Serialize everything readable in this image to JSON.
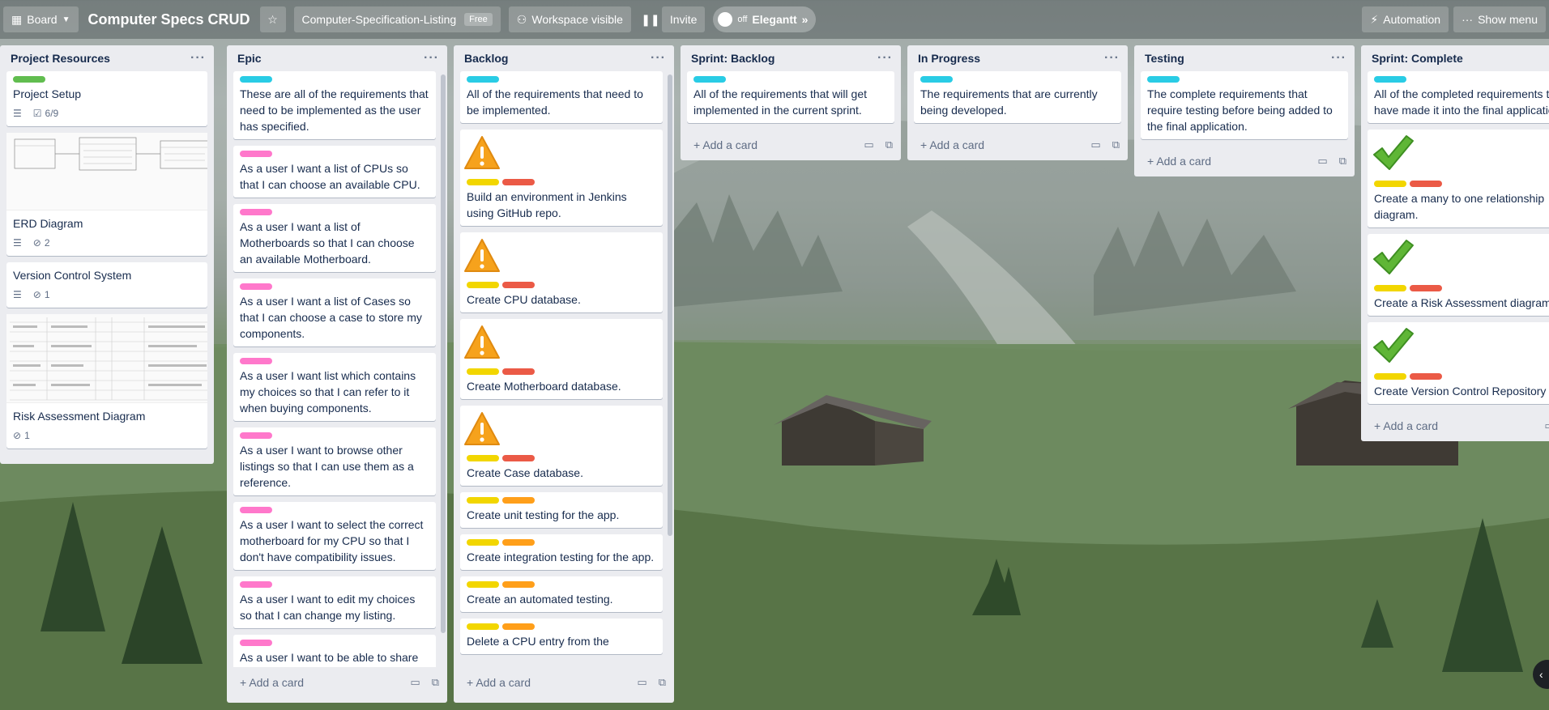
{
  "header": {
    "board_switcher": "Board",
    "board_title": "Computer Specs CRUD",
    "workspace_name": "Computer-Specification-Listing",
    "workspace_badge": "Free",
    "visibility": "Workspace visible",
    "invite": "Invite",
    "toggle_state": "off",
    "powerup_name": "Elegantt",
    "automation": "Automation",
    "show_menu": "Show menu"
  },
  "add_card_label": "Add a card",
  "colors": {
    "cyan": "#29cce5",
    "green": "#61bd4f",
    "pink": "#ff78cb",
    "yellow": "#f2d600",
    "red": "#eb5a46",
    "orange": "#ff9f1a"
  },
  "lists": [
    {
      "title": "Project Resources",
      "cards": [
        {
          "title": "Project Setup",
          "labels": [
            "green"
          ],
          "badges": {
            "description": true,
            "checklist": "6/9"
          }
        },
        {
          "title": "ERD Diagram",
          "cover": "erd",
          "badges": {
            "description": true,
            "attachments": "2"
          }
        },
        {
          "title": "Version Control System",
          "badges": {
            "description": true,
            "attachments": "1"
          }
        },
        {
          "title": "Risk Assessment Diagram",
          "cover": "table",
          "badges": {
            "attachments": "1"
          }
        }
      ]
    },
    {
      "title": "Epic",
      "cards": [
        {
          "title": "These are all of the requirements that need to be implemented as the user has specified.",
          "labels": [
            "cyan"
          ]
        },
        {
          "title": "As a user I want a list of CPUs so that I can choose an available CPU.",
          "labels": [
            "pink"
          ]
        },
        {
          "title": "As a user I want a list of Motherboards so that I can choose an available Motherboard.",
          "labels": [
            "pink"
          ]
        },
        {
          "title": "As a user I want a list of Cases so that I can choose a case to store my components.",
          "labels": [
            "pink"
          ]
        },
        {
          "title": "As a user I want list which contains my choices so that I can refer to it when buying components.",
          "labels": [
            "pink"
          ]
        },
        {
          "title": "As a user I want to browse other listings so that I can use them as a reference.",
          "labels": [
            "pink"
          ]
        },
        {
          "title": "As a user I want to select the correct motherboard for my CPU so that I don't have compatibility issues.",
          "labels": [
            "pink"
          ]
        },
        {
          "title": "As a user I want to edit my choices so that I can change my listing.",
          "labels": [
            "pink"
          ]
        },
        {
          "title": "As a user I want to be able to share",
          "labels": [
            "pink"
          ]
        }
      ]
    },
    {
      "title": "Backlog",
      "cards": [
        {
          "title": "All of the requirements that need to be implemented.",
          "labels": [
            "cyan"
          ]
        },
        {
          "title": "Build an environment in Jenkins using GitHub repo.",
          "icon": "warning-icon",
          "labels": [
            "yellow",
            "red"
          ]
        },
        {
          "title": "Create CPU database.",
          "icon": "warning-icon",
          "labels": [
            "yellow",
            "red"
          ]
        },
        {
          "title": "Create Motherboard database.",
          "icon": "warning-icon",
          "labels": [
            "yellow",
            "red"
          ]
        },
        {
          "title": "Create Case database.",
          "icon": "warning-icon",
          "labels": [
            "yellow",
            "red"
          ]
        },
        {
          "title": "Create unit testing for the app.",
          "labels": [
            "yellow",
            "orange"
          ]
        },
        {
          "title": "Create integration testing for the app.",
          "labels": [
            "yellow",
            "orange"
          ]
        },
        {
          "title": "Create an automated testing.",
          "labels": [
            "yellow",
            "orange"
          ]
        },
        {
          "title": "Delete a CPU entry from the",
          "labels": [
            "yellow",
            "orange"
          ]
        }
      ]
    },
    {
      "title": "Sprint: Backlog",
      "cards": [
        {
          "title": "All of the requirements that will get implemented in the current sprint.",
          "labels": [
            "cyan"
          ]
        }
      ]
    },
    {
      "title": "In Progress",
      "cards": [
        {
          "title": "The requirements that are currently being developed.",
          "labels": [
            "cyan"
          ]
        }
      ]
    },
    {
      "title": "Testing",
      "cards": [
        {
          "title": "The complete requirements that require testing before being added to the final application.",
          "labels": [
            "cyan"
          ]
        }
      ]
    },
    {
      "title": "Sprint: Complete",
      "cards": [
        {
          "title": "All of the completed requirements that have made it into the final application.",
          "labels": [
            "cyan"
          ]
        },
        {
          "title": "Create a many to one relationship diagram.",
          "icon": "checkmark-icon",
          "labels": [
            "yellow",
            "red"
          ]
        },
        {
          "title": "Create a Risk Assessment diagram.",
          "icon": "checkmark-icon",
          "labels": [
            "yellow",
            "red"
          ]
        },
        {
          "title": "Create Version Control Repository",
          "icon": "checkmark-icon",
          "labels": [
            "yellow",
            "red"
          ]
        }
      ]
    }
  ]
}
